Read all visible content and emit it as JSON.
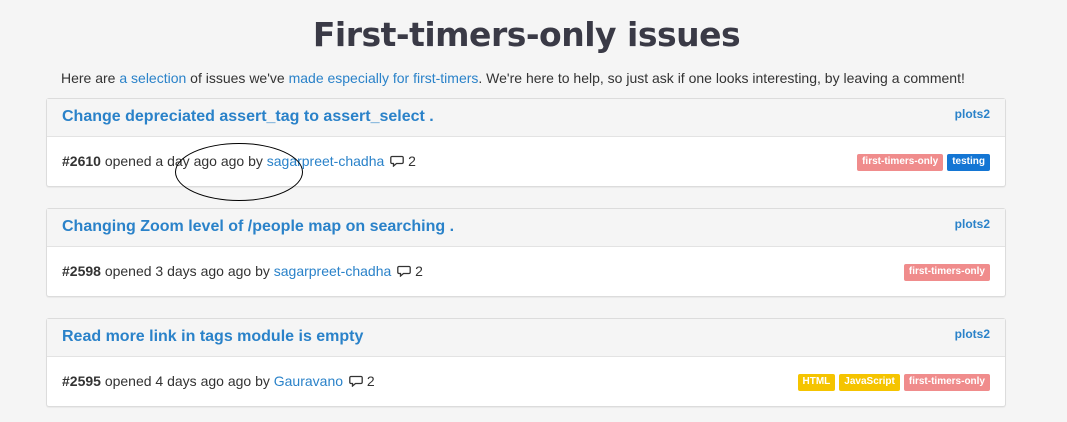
{
  "page": {
    "title": "First-timers-only issues",
    "intro": {
      "prefix": "Here are ",
      "link1": "a selection",
      "middle": " of issues we've ",
      "link2": "made especially for first-timers",
      "suffix": ". We're here to help, so just ask if one looks interesting, by leaving a comment!"
    }
  },
  "issues": [
    {
      "title": "Change depreciated assert_tag to assert_select .",
      "repo": "plots2",
      "number": "#2610",
      "opened": " opened a day ago ago by ",
      "author": "sagarpreet-chadha",
      "comments": "2",
      "labels": [
        {
          "text": "first-timers-only",
          "color": "#f08c8c"
        },
        {
          "text": "testing",
          "color": "#1476d4"
        }
      ]
    },
    {
      "title": "Changing Zoom level of /people map on searching .",
      "repo": "plots2",
      "number": "#2598",
      "opened": " opened 3 days ago ago by ",
      "author": "sagarpreet-chadha",
      "comments": "2",
      "labels": [
        {
          "text": "first-timers-only",
          "color": "#f08c8c"
        }
      ]
    },
    {
      "title": "Read more link in tags module is empty",
      "repo": "plots2",
      "number": "#2595",
      "opened": " opened 4 days ago ago by ",
      "author": "Gauravano",
      "comments": "2",
      "labels": [
        {
          "text": "HTML",
          "color": "#f5c400"
        },
        {
          "text": "JavaScript",
          "color": "#f5c400"
        },
        {
          "text": "first-timers-only",
          "color": "#f08c8c"
        }
      ]
    }
  ]
}
